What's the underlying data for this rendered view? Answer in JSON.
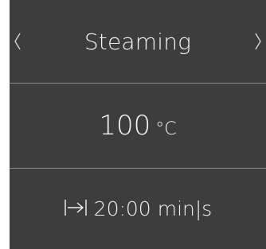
{
  "mode": {
    "label": "Steaming",
    "prev_icon": "chevron-left-icon",
    "next_icon": "chevron-right-icon"
  },
  "temperature": {
    "value": "100",
    "unit": "°C"
  },
  "duration": {
    "icon": "duration-icon",
    "value": "20:00",
    "unit": "min|s"
  },
  "colors": {
    "panel_bg": "#3d3d3d",
    "text": "#f2f2f2",
    "divider": "#8a8a8a"
  }
}
